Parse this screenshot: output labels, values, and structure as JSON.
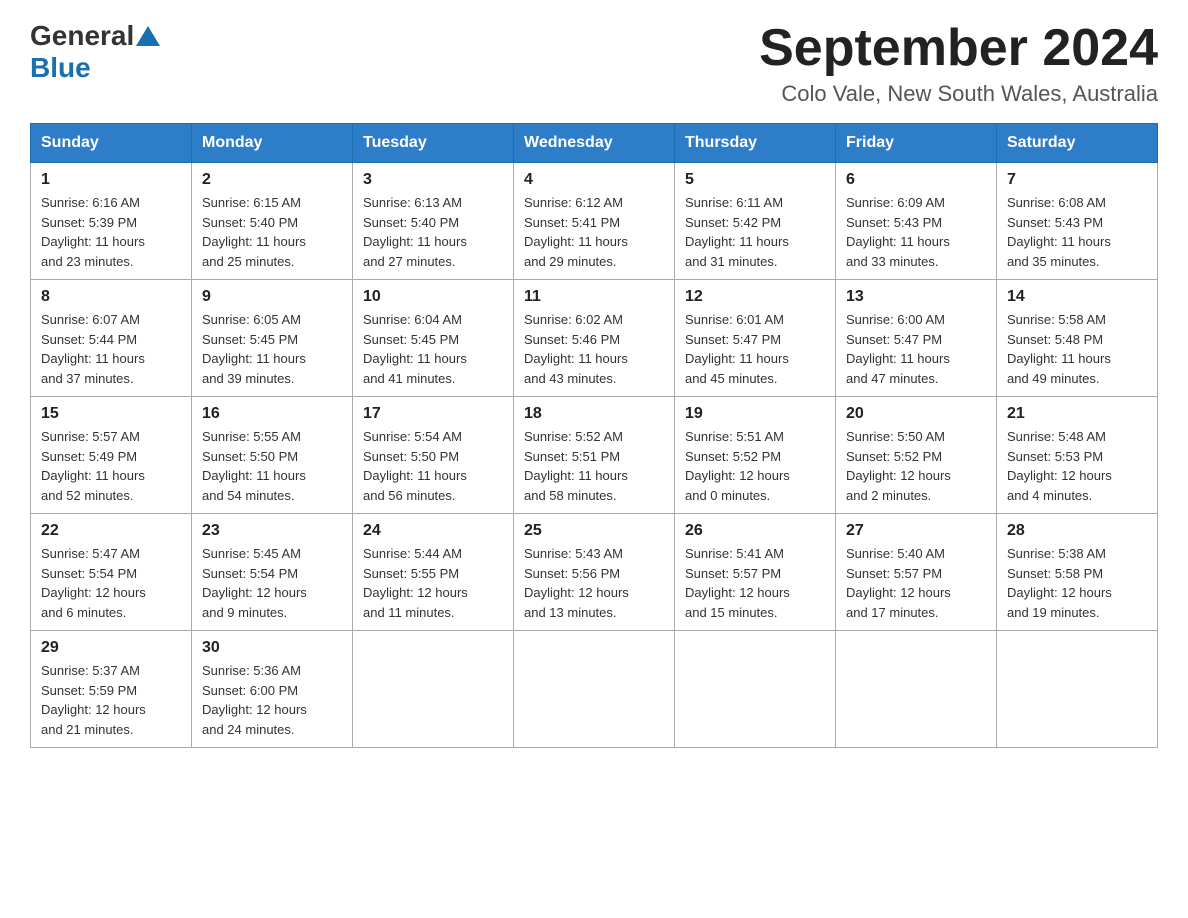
{
  "logo": {
    "text_general": "General",
    "text_blue": "Blue"
  },
  "header": {
    "month": "September 2024",
    "location": "Colo Vale, New South Wales, Australia"
  },
  "weekdays": [
    "Sunday",
    "Monday",
    "Tuesday",
    "Wednesday",
    "Thursday",
    "Friday",
    "Saturday"
  ],
  "weeks": [
    [
      {
        "day": "1",
        "sunrise": "6:16 AM",
        "sunset": "5:39 PM",
        "daylight": "11 hours and 23 minutes."
      },
      {
        "day": "2",
        "sunrise": "6:15 AM",
        "sunset": "5:40 PM",
        "daylight": "11 hours and 25 minutes."
      },
      {
        "day": "3",
        "sunrise": "6:13 AM",
        "sunset": "5:40 PM",
        "daylight": "11 hours and 27 minutes."
      },
      {
        "day": "4",
        "sunrise": "6:12 AM",
        "sunset": "5:41 PM",
        "daylight": "11 hours and 29 minutes."
      },
      {
        "day": "5",
        "sunrise": "6:11 AM",
        "sunset": "5:42 PM",
        "daylight": "11 hours and 31 minutes."
      },
      {
        "day": "6",
        "sunrise": "6:09 AM",
        "sunset": "5:43 PM",
        "daylight": "11 hours and 33 minutes."
      },
      {
        "day": "7",
        "sunrise": "6:08 AM",
        "sunset": "5:43 PM",
        "daylight": "11 hours and 35 minutes."
      }
    ],
    [
      {
        "day": "8",
        "sunrise": "6:07 AM",
        "sunset": "5:44 PM",
        "daylight": "11 hours and 37 minutes."
      },
      {
        "day": "9",
        "sunrise": "6:05 AM",
        "sunset": "5:45 PM",
        "daylight": "11 hours and 39 minutes."
      },
      {
        "day": "10",
        "sunrise": "6:04 AM",
        "sunset": "5:45 PM",
        "daylight": "11 hours and 41 minutes."
      },
      {
        "day": "11",
        "sunrise": "6:02 AM",
        "sunset": "5:46 PM",
        "daylight": "11 hours and 43 minutes."
      },
      {
        "day": "12",
        "sunrise": "6:01 AM",
        "sunset": "5:47 PM",
        "daylight": "11 hours and 45 minutes."
      },
      {
        "day": "13",
        "sunrise": "6:00 AM",
        "sunset": "5:47 PM",
        "daylight": "11 hours and 47 minutes."
      },
      {
        "day": "14",
        "sunrise": "5:58 AM",
        "sunset": "5:48 PM",
        "daylight": "11 hours and 49 minutes."
      }
    ],
    [
      {
        "day": "15",
        "sunrise": "5:57 AM",
        "sunset": "5:49 PM",
        "daylight": "11 hours and 52 minutes."
      },
      {
        "day": "16",
        "sunrise": "5:55 AM",
        "sunset": "5:50 PM",
        "daylight": "11 hours and 54 minutes."
      },
      {
        "day": "17",
        "sunrise": "5:54 AM",
        "sunset": "5:50 PM",
        "daylight": "11 hours and 56 minutes."
      },
      {
        "day": "18",
        "sunrise": "5:52 AM",
        "sunset": "5:51 PM",
        "daylight": "11 hours and 58 minutes."
      },
      {
        "day": "19",
        "sunrise": "5:51 AM",
        "sunset": "5:52 PM",
        "daylight": "12 hours and 0 minutes."
      },
      {
        "day": "20",
        "sunrise": "5:50 AM",
        "sunset": "5:52 PM",
        "daylight": "12 hours and 2 minutes."
      },
      {
        "day": "21",
        "sunrise": "5:48 AM",
        "sunset": "5:53 PM",
        "daylight": "12 hours and 4 minutes."
      }
    ],
    [
      {
        "day": "22",
        "sunrise": "5:47 AM",
        "sunset": "5:54 PM",
        "daylight": "12 hours and 6 minutes."
      },
      {
        "day": "23",
        "sunrise": "5:45 AM",
        "sunset": "5:54 PM",
        "daylight": "12 hours and 9 minutes."
      },
      {
        "day": "24",
        "sunrise": "5:44 AM",
        "sunset": "5:55 PM",
        "daylight": "12 hours and 11 minutes."
      },
      {
        "day": "25",
        "sunrise": "5:43 AM",
        "sunset": "5:56 PM",
        "daylight": "12 hours and 13 minutes."
      },
      {
        "day": "26",
        "sunrise": "5:41 AM",
        "sunset": "5:57 PM",
        "daylight": "12 hours and 15 minutes."
      },
      {
        "day": "27",
        "sunrise": "5:40 AM",
        "sunset": "5:57 PM",
        "daylight": "12 hours and 17 minutes."
      },
      {
        "day": "28",
        "sunrise": "5:38 AM",
        "sunset": "5:58 PM",
        "daylight": "12 hours and 19 minutes."
      }
    ],
    [
      {
        "day": "29",
        "sunrise": "5:37 AM",
        "sunset": "5:59 PM",
        "daylight": "12 hours and 21 minutes."
      },
      {
        "day": "30",
        "sunrise": "5:36 AM",
        "sunset": "6:00 PM",
        "daylight": "12 hours and 24 minutes."
      },
      null,
      null,
      null,
      null,
      null
    ]
  ],
  "labels": {
    "sunrise": "Sunrise:",
    "sunset": "Sunset:",
    "daylight": "Daylight:"
  }
}
